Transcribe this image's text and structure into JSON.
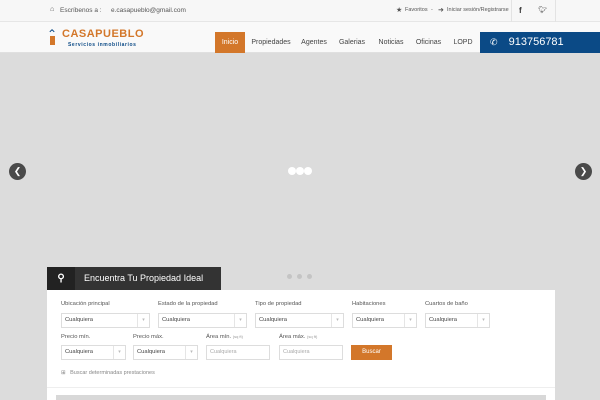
{
  "topbar": {
    "email_prefix": "Escríbenos a :",
    "email": "e.casapueblo@gmail.com",
    "favorites": "Favoritos",
    "separator": "-",
    "login": "Iniciar sesión/Registrarse"
  },
  "logo": {
    "name": "CASAPUEBLO",
    "tagline": "Servicios inmobiliarios"
  },
  "nav": [
    "Inicio",
    "Propiedades",
    "Agentes",
    "Galerias",
    "Noticias",
    "Oficinas",
    "LOPD"
  ],
  "phone": "913756781",
  "search": {
    "title": "Encuentra Tu Propiedad Ideal",
    "row1": [
      {
        "label": "Ubicación principal",
        "value": "Cualquiera"
      },
      {
        "label": "Estado de la propiedad",
        "value": "Cualquiera"
      },
      {
        "label": "Tipo de propiedad",
        "value": "Cualquiera"
      },
      {
        "label": "Habitaciones",
        "value": "Cualquiera"
      },
      {
        "label": "Cuartos de baño",
        "value": "Cualquiera"
      }
    ],
    "row2": [
      {
        "label": "Precio mín.",
        "value": "Cualquiera"
      },
      {
        "label": "Precio máx.",
        "value": "Cualquiera"
      }
    ],
    "areas": [
      {
        "label": "Área mín.",
        "unit": "(sq ft)",
        "placeholder": "Cualquiera"
      },
      {
        "label": "Área máx.",
        "unit": "(sq ft)",
        "placeholder": "Cualquiera"
      }
    ],
    "button": "Buscar",
    "features_link": "Buscar determinadas prestaciones"
  },
  "colors": {
    "accent": "#d3772a",
    "phone_bg": "#0b4a86"
  }
}
